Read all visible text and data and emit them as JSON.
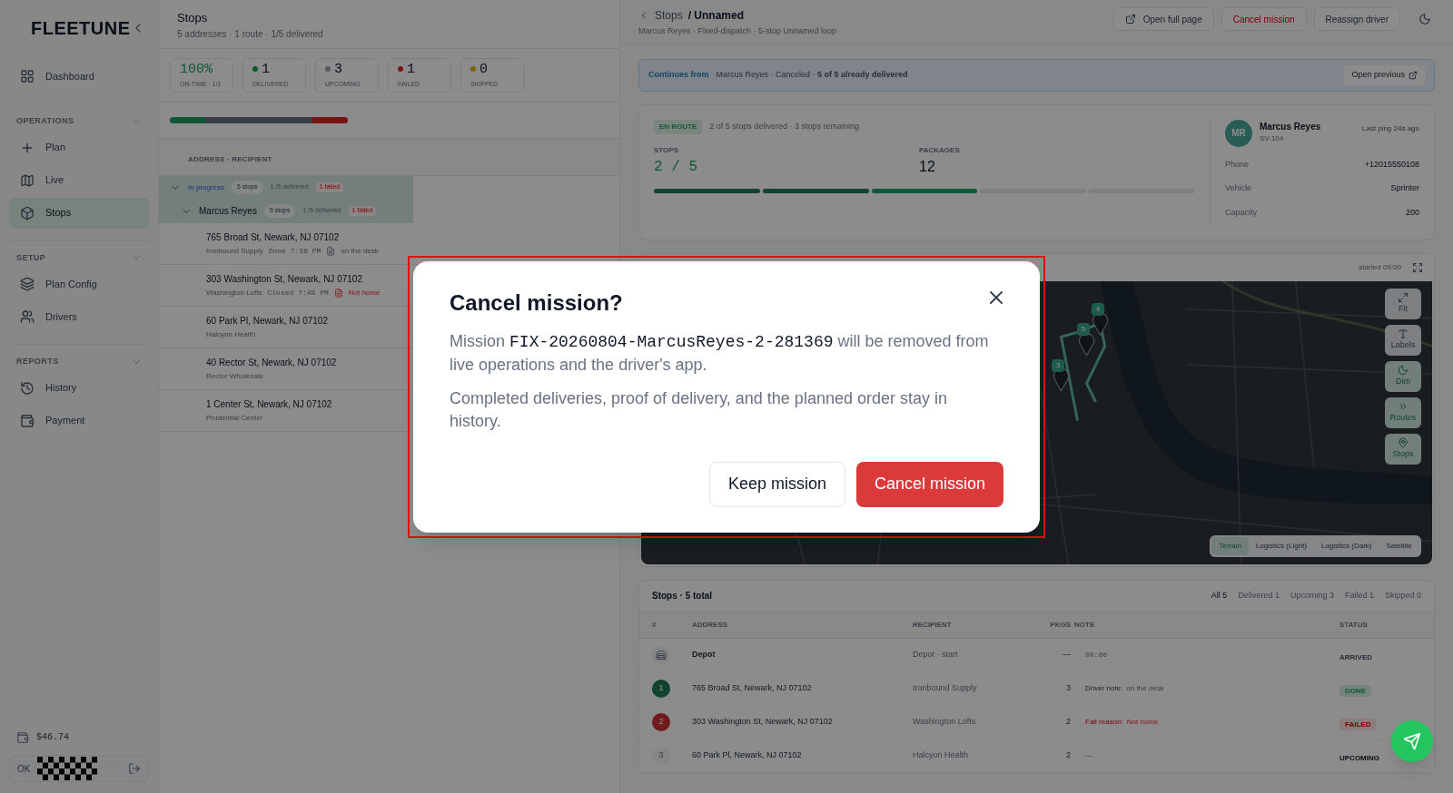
{
  "sidebar": {
    "logo": "FLEETUNE",
    "items": [
      {
        "kind": "item",
        "label": "Dashboard",
        "selected": false
      },
      {
        "kind": "section",
        "label": "OPERATIONS"
      },
      {
        "kind": "item",
        "label": "Plan",
        "selected": false
      },
      {
        "kind": "item",
        "label": "Live",
        "selected": false
      },
      {
        "kind": "item",
        "label": "Stops",
        "selected": true
      },
      {
        "kind": "section",
        "label": "SETUP"
      },
      {
        "kind": "item",
        "label": "Plan Config",
        "selected": false
      },
      {
        "kind": "item",
        "label": "Drivers",
        "selected": false
      },
      {
        "kind": "section",
        "label": "REPORTS"
      },
      {
        "kind": "item",
        "label": "History",
        "selected": false
      },
      {
        "kind": "item",
        "label": "Payment",
        "selected": false
      }
    ],
    "balance": "$46.74",
    "user_initials": "OK"
  },
  "stops_panel": {
    "title": "Stops",
    "subtitle": "5 addresses · 1 route · 1/5 delivered",
    "stats": [
      {
        "kind": "ontime",
        "value": "100%",
        "label": "ON-TIME · 1/1"
      },
      {
        "kind": "delivered",
        "value": "1",
        "label": "DELIVERED"
      },
      {
        "kind": "upcoming",
        "value": "3",
        "label": "UPCOMING"
      },
      {
        "kind": "failed",
        "value": "1",
        "label": "FAILED"
      },
      {
        "kind": "skipped",
        "value": "0",
        "label": "SKIPPED"
      }
    ],
    "progress": [
      {
        "kind": "delivered"
      },
      {
        "kind": "upcoming"
      },
      {
        "kind": "upcoming"
      },
      {
        "kind": "upcoming"
      },
      {
        "kind": "failed"
      }
    ],
    "column_header": "ADDRESS · RECIPIENT",
    "groups": [
      {
        "kind": "status",
        "label": "In progress",
        "count": "5 stops",
        "delivered": "1 /5 delivered",
        "failed": "1 failed",
        "expanded": true
      },
      {
        "kind": "driver",
        "label": "Marcus Reyes",
        "count": "5 stops",
        "delivered": "1 /5 delivered",
        "failed": "1 failed",
        "expanded": true
      }
    ],
    "stops": [
      {
        "address": "765 Broad St, Newark, NJ 07102",
        "recipient": "Ironbound Supply",
        "state": "Done",
        "time": "7:38 PM",
        "note": "on the desk",
        "failed": false
      },
      {
        "address": "303 Washington St, Newark, NJ 07102",
        "recipient": "Washington Lofts",
        "state": "Closed",
        "time": "7:48 PM",
        "note": "Not home",
        "failed": true
      },
      {
        "address": "60 Park Pl, Newark, NJ 07102",
        "recipient": "Halcyon Health"
      },
      {
        "address": "40 Rector St, Newark, NJ 07102",
        "recipient": "Rector Wholesale"
      },
      {
        "address": "1 Center St, Newark, NJ 07102",
        "recipient": "Prudential Center"
      }
    ]
  },
  "detail": {
    "breadcrumb": {
      "parent": "Stops",
      "current": "/ Unnamed"
    },
    "subtitle": "Marcus Reyes · Fixed-dispatch · 5-stop Unnamed loop",
    "actions": [
      {
        "kind": "link",
        "label": "Open full page"
      },
      {
        "kind": "danger",
        "label": "Cancel mission"
      },
      {
        "kind": "plain",
        "label": "Reassign driver"
      }
    ],
    "banner": {
      "label": "Continues from",
      "text": "Marcus Reyes · Canceled · **5 of 5 already delivered**",
      "button": "Open previous"
    },
    "summary": {
      "badge": "EN ROUTE",
      "text": "2 of 5 stops delivered · 3 stops remaining",
      "stops_label": "STOPS",
      "stops_value": "2 / 5",
      "packages_label": "PACKAGES",
      "packages_value": "12",
      "segments": [
        {
          "kind": "done"
        },
        {
          "kind": "done"
        },
        {
          "kind": "current"
        },
        {
          "kind": "pending"
        },
        {
          "kind": "pending"
        }
      ]
    },
    "driver": {
      "initials": "MR",
      "name": "Marcus Reyes",
      "vehicle_id": "SV-104",
      "last_ping": "Last ping 24s ago",
      "fields": [
        {
          "label": "Phone",
          "value": "+12015550108"
        },
        {
          "label": "Vehicle",
          "value": "Sprinter"
        },
        {
          "label": "Capacity",
          "value": "200"
        }
      ]
    },
    "map": {
      "started": "started 09:00",
      "markers": [
        "4",
        "5",
        "3"
      ],
      "controls": [
        {
          "label": "Fit",
          "active": false
        },
        {
          "label": "Labels",
          "active": false
        },
        {
          "label": "Dim",
          "active": true
        },
        {
          "label": "Routes",
          "active": true
        },
        {
          "label": "Stops",
          "active": true
        }
      ],
      "styles": [
        {
          "label": "Terrain",
          "selected": true
        },
        {
          "label": "Logistics (Light)",
          "selected": false
        },
        {
          "label": "Logistics (Dark)",
          "selected": false
        },
        {
          "label": "Satellite",
          "selected": false
        }
      ]
    },
    "table": {
      "title": "Stops · 5 total",
      "filters": [
        {
          "label": "All 5",
          "selected": true
        },
        {
          "label": "Delivered 1",
          "selected": false
        },
        {
          "label": "Upcoming 3",
          "selected": false
        },
        {
          "label": "Failed 1",
          "selected": false
        },
        {
          "label": "Skipped 0",
          "selected": false
        }
      ],
      "columns": [
        "#",
        "ADDRESS",
        "RECIPIENT",
        "PKGS",
        "NOTE",
        "STATUS"
      ],
      "rows": [
        {
          "kind": "depot",
          "address": "Depot",
          "recipient": "Depot · start",
          "pkgs": "—",
          "note": "09:00",
          "status": "ARRIVED"
        },
        {
          "kind": "done",
          "index": "1",
          "address": "765 Broad St, Newark, NJ 07102",
          "recipient": "Ironbound Supply",
          "pkgs": "3",
          "note_label": "Driver note:",
          "note": "on the desk",
          "status": "DONE"
        },
        {
          "kind": "failed",
          "index": "2",
          "address": "303 Washington St, Newark, NJ 07102",
          "recipient": "Washington Lofts",
          "pkgs": "2",
          "note_label": "Fail reason:",
          "note": "Not home",
          "status": "FAILED"
        },
        {
          "kind": "pending",
          "index": "3",
          "address": "60 Park Pl, Newark, NJ 07102",
          "recipient": "Halcyon Health",
          "pkgs": "2",
          "note": "—",
          "status": "UPCOMING"
        }
      ]
    }
  },
  "dialog": {
    "title": "Cancel mission?",
    "body": "Mission",
    "mission_id": "FIX-20260804-MarcusReyes-2-281369",
    "body_rest": "will be removed from live operations and the driver's app.",
    "note": "Completed deliveries, proof of delivery, and the planned order stay in history.",
    "buttons": [
      {
        "kind": "secondary",
        "label": "Keep mission"
      },
      {
        "kind": "danger",
        "label": "Cancel mission"
      }
    ]
  }
}
